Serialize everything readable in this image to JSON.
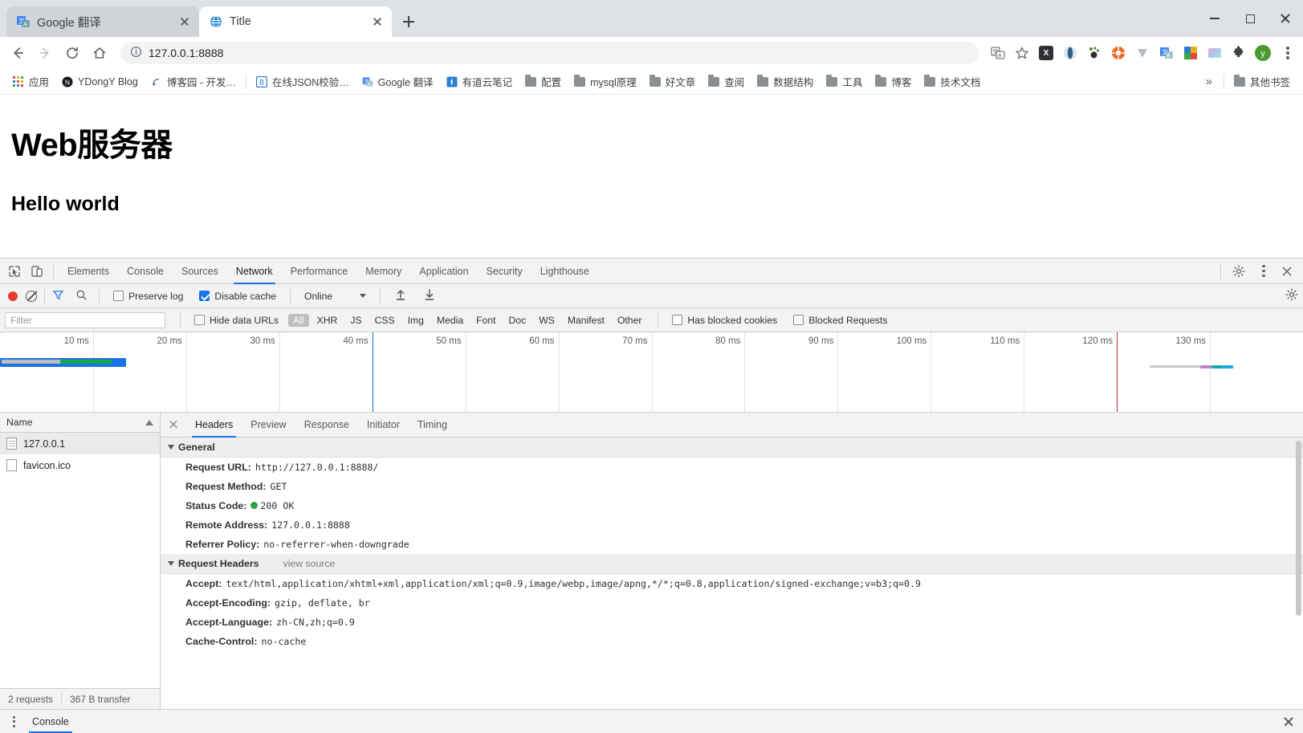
{
  "browser": {
    "tabs": [
      {
        "title": "Google 翻译",
        "favicon": "google-translate-icon",
        "active": false
      },
      {
        "title": "Title",
        "favicon": "globe-icon",
        "active": true
      }
    ],
    "newtab_label": "+",
    "window_controls": [
      "minimize",
      "maximize",
      "close"
    ],
    "nav": {
      "back": "back-arrow-icon",
      "forward": "forward-arrow-icon",
      "reload": "reload-icon",
      "home": "home-icon"
    },
    "omnibox": {
      "info_icon": "info-circle-icon",
      "url_host": "127.0.0.1",
      "url_port": ":8888",
      "full_url": "127.0.0.1:8888"
    },
    "toolbar_icons": [
      "translate-icon",
      "bookmark-star-icon",
      "xmind-extension-icon",
      "opera-extension-icon",
      "gnome-extension-icon",
      "lifebuoy-extension-icon",
      "v-extension-icon",
      "google-translate-extension-icon",
      "photos-extension-icon",
      "gradient-extension-icon",
      "puzzle-extensions-icon"
    ],
    "profile_initial": "y",
    "menu_icon": "three-dots-menu-icon"
  },
  "bookmarks": {
    "apps_label": "应用",
    "items": [
      {
        "label": "YDongY Blog",
        "icon": "n-badge-icon"
      },
      {
        "label": "博客园 - 开发…",
        "icon": "cnblogs-icon"
      },
      {
        "label": "在线JSON校验…",
        "icon": "b-badge-icon"
      },
      {
        "label": "Google 翻译",
        "icon": "google-translate-icon"
      },
      {
        "label": "有道云笔记",
        "icon": "youdao-icon"
      },
      {
        "label": "配置",
        "icon": "folder-icon"
      },
      {
        "label": "mysql原理",
        "icon": "folder-icon"
      },
      {
        "label": "好文章",
        "icon": "folder-icon"
      },
      {
        "label": "查阅",
        "icon": "folder-icon"
      },
      {
        "label": "数据结构",
        "icon": "folder-icon"
      },
      {
        "label": "工具",
        "icon": "folder-icon"
      },
      {
        "label": "博客",
        "icon": "folder-icon"
      },
      {
        "label": "技术文档",
        "icon": "folder-icon"
      }
    ],
    "overflow_label": "»",
    "other_bookmarks": {
      "label": "其他书签",
      "icon": "folder-icon"
    }
  },
  "page": {
    "heading": "Web服务器",
    "subheading": "Hello world"
  },
  "devtools": {
    "inspect_icon": "inspect-element-icon",
    "device_icon": "device-toolbar-icon",
    "tabs": [
      {
        "label": "Elements",
        "selected": false
      },
      {
        "label": "Console",
        "selected": false
      },
      {
        "label": "Sources",
        "selected": false
      },
      {
        "label": "Network",
        "selected": true
      },
      {
        "label": "Performance",
        "selected": false
      },
      {
        "label": "Memory",
        "selected": false
      },
      {
        "label": "Application",
        "selected": false
      },
      {
        "label": "Security",
        "selected": false
      },
      {
        "label": "Lighthouse",
        "selected": false
      }
    ],
    "settings_icon": "gear-icon",
    "more_icon": "three-dots-menu-icon",
    "close_icon": "close-icon",
    "toolbar": {
      "record_icon": "record-stop-icon",
      "clear_icon": "clear-ban-icon",
      "filter_icon": "funnel-filter-icon",
      "search_icon": "search-icon",
      "preserve_log": {
        "label": "Preserve log",
        "checked": false
      },
      "disable_cache": {
        "label": "Disable cache",
        "checked": true
      },
      "throttling": {
        "value": "Online"
      },
      "import_icon": "upload-har-icon",
      "export_icon": "download-har-icon",
      "network_settings_icon": "gear-icon"
    },
    "filterbar": {
      "filter_placeholder": "Filter",
      "hide_data_urls": {
        "label": "Hide data URLs",
        "checked": false
      },
      "types": [
        "All",
        "XHR",
        "JS",
        "CSS",
        "Img",
        "Media",
        "Font",
        "Doc",
        "WS",
        "Manifest",
        "Other"
      ],
      "selected_type": "All",
      "has_blocked_cookies": {
        "label": "Has blocked cookies",
        "checked": false
      },
      "blocked_requests": {
        "label": "Blocked Requests",
        "checked": false
      }
    },
    "overview": {
      "ticks": [
        "10 ms",
        "20 ms",
        "30 ms",
        "40 ms",
        "50 ms",
        "60 ms",
        "70 ms",
        "80 ms",
        "90 ms",
        "100 ms",
        "110 ms",
        "120 ms",
        "130 ms"
      ],
      "max_ms": 140,
      "requests": [
        {
          "name": "127.0.0.1",
          "start_ms": 0,
          "wait_end_ms": 6.5,
          "download_end_ms": 12.0,
          "total_end_ms": 13.5
        },
        {
          "name": "favicon.ico",
          "start_ms": 123.5,
          "wait_end_ms": 129.0,
          "download_end_ms": 131.5,
          "total_end_ms": 132.5
        }
      ],
      "markers": [
        {
          "name": "DOMContentLoaded",
          "ms": 40.0,
          "color": "#1a6fdb"
        },
        {
          "name": "Load",
          "ms": 120.0,
          "color": "#c5312f"
        }
      ]
    },
    "request_list": {
      "column_header": "Name",
      "sort_icon": "sort-ascending-icon",
      "rows": [
        {
          "name": "127.0.0.1",
          "icon": "document-icon",
          "selected": true
        },
        {
          "name": "favicon.ico",
          "icon": "blank-document-icon",
          "selected": false
        }
      ],
      "footer": {
        "requests": "2 requests",
        "transferred": "367 B transfer"
      }
    },
    "detail": {
      "close_icon": "close-icon",
      "tabs": [
        {
          "label": "Headers",
          "selected": true
        },
        {
          "label": "Preview",
          "selected": false
        },
        {
          "label": "Response",
          "selected": false
        },
        {
          "label": "Initiator",
          "selected": false
        },
        {
          "label": "Timing",
          "selected": false
        }
      ],
      "sections": [
        {
          "title": "General",
          "view_source": "",
          "rows": [
            {
              "name": "Request URL:",
              "value": "http://127.0.0.1:8888/",
              "status_dot": false
            },
            {
              "name": "Request Method:",
              "value": "GET",
              "status_dot": false
            },
            {
              "name": "Status Code:",
              "value": "200 OK",
              "status_dot": true
            },
            {
              "name": "Remote Address:",
              "value": "127.0.0.1:8888",
              "status_dot": false
            },
            {
              "name": "Referrer Policy:",
              "value": "no-referrer-when-downgrade",
              "status_dot": false
            }
          ]
        },
        {
          "title": "Request Headers",
          "view_source": "view source",
          "rows": [
            {
              "name": "Accept:",
              "value": "text/html,application/xhtml+xml,application/xml;q=0.9,image/webp,image/apng,*/*;q=0.8,application/signed-exchange;v=b3;q=0.9",
              "status_dot": false
            },
            {
              "name": "Accept-Encoding:",
              "value": "gzip, deflate, br",
              "status_dot": false
            },
            {
              "name": "Accept-Language:",
              "value": "zh-CN,zh;q=0.9",
              "status_dot": false
            },
            {
              "name": "Cache-Control:",
              "value": "no-cache",
              "status_dot": false
            }
          ]
        }
      ]
    },
    "console_drawer": {
      "more_icon": "three-dots-menu-icon",
      "tab_label": "Console",
      "close_icon": "close-icon"
    }
  },
  "colors": {
    "accent": "#1a73e8",
    "record_red": "#e33b2e",
    "status_green": "#2aa243",
    "tabstrip_bg": "#dee1e6",
    "devtools_bg": "#f3f3f3"
  }
}
